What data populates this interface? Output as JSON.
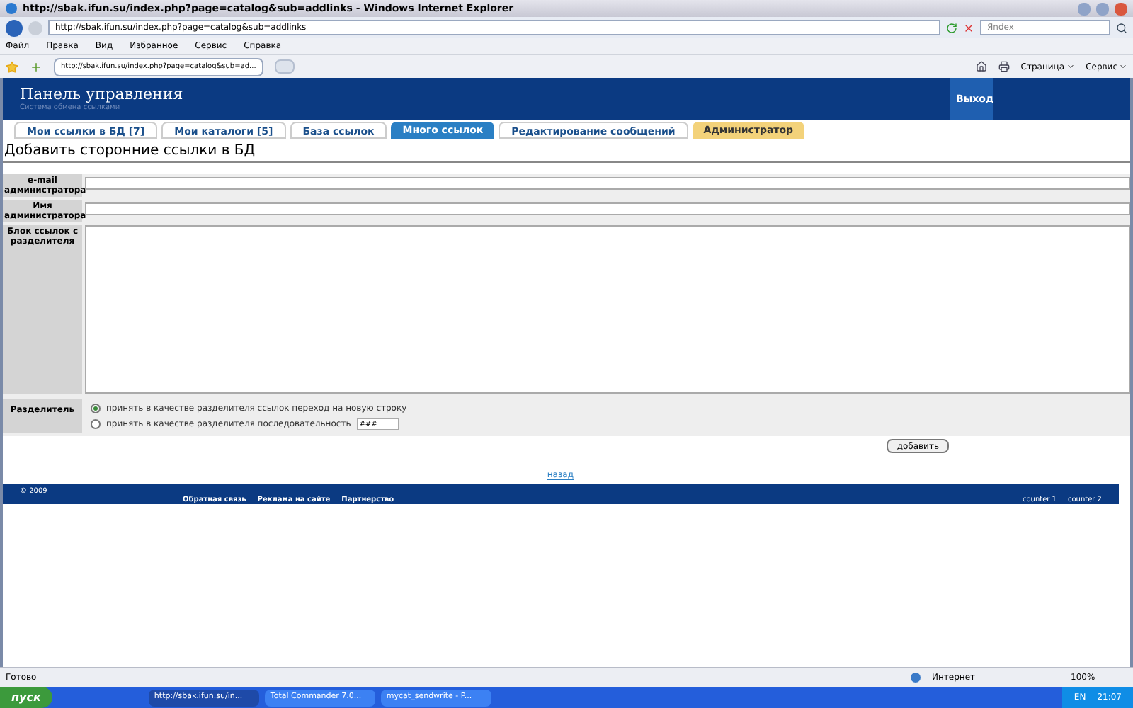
{
  "window": {
    "title": "http://sbak.ifun.su/index.php?page=catalog&sub=addlinks - Windows Internet Explorer"
  },
  "address_bar": {
    "value": "http://sbak.ifun.su/index.php?page=catalog&sub=addlinks",
    "search_placeholder": "Яndex"
  },
  "menu": [
    "Файл",
    "Правка",
    "Вид",
    "Избранное",
    "Сервис",
    "Справка"
  ],
  "browser_tab": {
    "title": "http://sbak.ifun.su/index.php?page=catalog&sub=ad..."
  },
  "command_bar": [
    "Страница",
    "Сервис"
  ],
  "page": {
    "header": {
      "title": "Панель управления",
      "subtitle": "Система обмена ссылками",
      "logout": "Выход"
    },
    "tabs": [
      {
        "label": "Мои ссылки в БД [7]",
        "selected": false,
        "kind": "normal"
      },
      {
        "label": "Мои каталоги [5]",
        "selected": false,
        "kind": "normal"
      },
      {
        "label": "База ссылок",
        "selected": false,
        "kind": "normal"
      },
      {
        "label": "Много ссылок",
        "selected": true,
        "kind": "normal"
      },
      {
        "label": "Редактирование сообщений",
        "selected": false,
        "kind": "normal"
      },
      {
        "label": "Администратор",
        "selected": false,
        "kind": "admin"
      }
    ],
    "heading": "Добавить сторонние ссылки в БД",
    "fields": [
      {
        "label": "e-mail администратора",
        "kind": "input"
      },
      {
        "label": "Имя администратора",
        "kind": "input"
      },
      {
        "label": "Блок ссылок с разделителя",
        "kind": "textarea"
      }
    ],
    "separator": {
      "label": "Разделитель",
      "options": [
        {
          "label": "принять в качестве разделителя ссылок переход на новую строку",
          "selected": true
        },
        {
          "label": "принять в качестве разделителя последовательность",
          "selected": false,
          "value": "###"
        }
      ]
    },
    "submit": "добавить",
    "back_link": "назад",
    "footer": {
      "copyright": "© 2009",
      "links": [
        "Обратная связь",
        "Реклама на сайте",
        "Партнерство"
      ],
      "counters": [
        "counter 1",
        "counter 2"
      ]
    }
  },
  "status_bar": {
    "text": "Готово",
    "zone": "Интернет",
    "zoom": "100%"
  },
  "taskbar": {
    "start": "пуск",
    "tasks": [
      {
        "label": "http://sbak.ifun.su/in...",
        "selected": true
      },
      {
        "label": "Total Commander 7.0...",
        "selected": false
      },
      {
        "label": "mycat_sendwrite - P...",
        "selected": false
      }
    ],
    "lang": "EN",
    "clock": "21:07"
  }
}
